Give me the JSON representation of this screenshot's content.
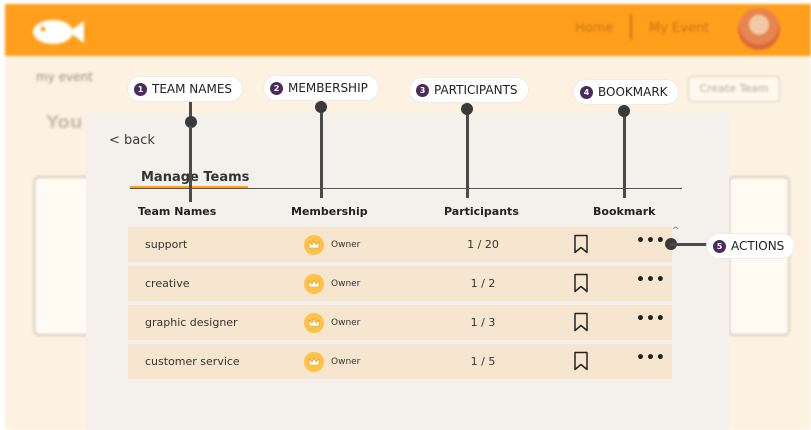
{
  "topbar": {
    "nav_home": "Home",
    "nav_event": "My Event"
  },
  "background": {
    "breadcrumb": "my event",
    "create_team_label": "Create Team",
    "heading_fragment": "You"
  },
  "modal": {
    "back_label": "< back",
    "section_title": "Manage Teams",
    "columns": {
      "team_names": "Team Names",
      "membership": "Membership",
      "participants": "Participants",
      "bookmark": "Bookmark"
    },
    "rows": [
      {
        "name": "support",
        "role": "Owner",
        "participants": "1 / 20",
        "actions": "•••"
      },
      {
        "name": "creative",
        "role": "Owner",
        "participants": "1 / 2",
        "actions": "•••"
      },
      {
        "name": "graphic designer",
        "role": "Owner",
        "participants": "1 / 3",
        "actions": "•••"
      },
      {
        "name": "customer service",
        "role": "Owner",
        "participants": "1 / 5",
        "actions": "•••"
      }
    ]
  },
  "callouts": [
    {
      "num": "1",
      "label": "TEAM NAMES"
    },
    {
      "num": "2",
      "label": "MEMBERSHIP"
    },
    {
      "num": "3",
      "label": "PARTICIPANTS"
    },
    {
      "num": "4",
      "label": "BOOKMARK"
    },
    {
      "num": "5",
      "label": "ACTIONS"
    }
  ],
  "colors": {
    "brand_orange": "#ff9f1c",
    "row_bg": "#f6e6d0",
    "crown_gold": "#ffc247",
    "callout_badge": "#4a2c5c"
  },
  "icons": {
    "logo": "fish-logo-icon",
    "membership": "crown-icon",
    "bookmark": "bookmark-icon",
    "actions": "more-dots-icon"
  }
}
